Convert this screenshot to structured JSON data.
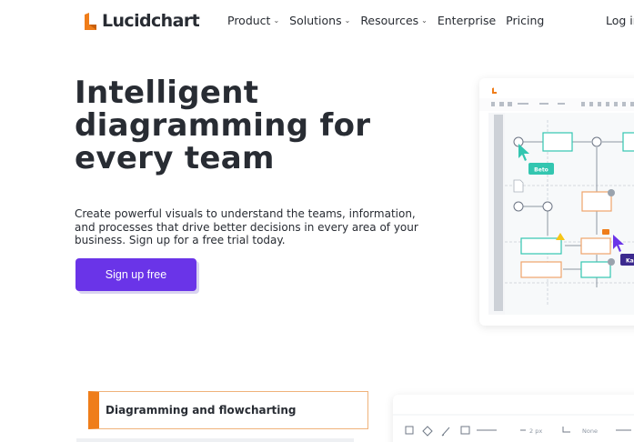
{
  "nav": {
    "logo_text": "Lucidchart",
    "menu": [
      {
        "label": "Product",
        "dropdown": true
      },
      {
        "label": "Solutions",
        "dropdown": true
      },
      {
        "label": "Resources",
        "dropdown": true
      },
      {
        "label": "Enterprise",
        "dropdown": false
      },
      {
        "label": "Pricing",
        "dropdown": false
      }
    ],
    "login_label": "Log in"
  },
  "hero": {
    "title": "Intelligent diagramming for every team",
    "subtitle": "Create powerful visuals to understand the teams, information, and processes that drive better decisions in every area of your business. Sign up for a free trial today.",
    "cta_label": "Sign up free"
  },
  "preview": {
    "collaborator_1": "Beto",
    "collaborator_2": "Ka"
  },
  "feature": {
    "card_title": "Diagramming and flowcharting"
  },
  "toolbar": {
    "stroke_width": "2 px",
    "arrow_style": "None"
  },
  "colors": {
    "brand_orange": "#ef7d1a",
    "cta_purple": "#6a34e8",
    "teal": "#33c6b0",
    "text_dark": "#282c33"
  }
}
